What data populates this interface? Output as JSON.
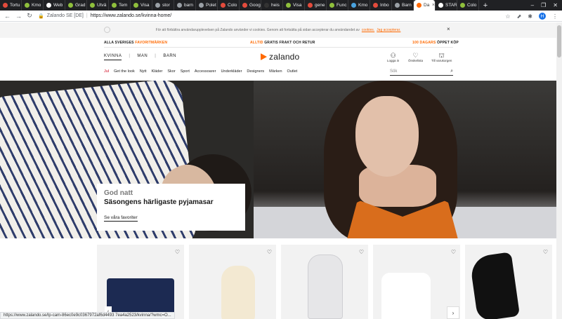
{
  "browser": {
    "tabs": [
      {
        "title": "Tortu",
        "color": "#e34b3c"
      },
      {
        "title": "Kmo",
        "color": "#8fbf3c"
      },
      {
        "title": "Web",
        "color": "#ffffff"
      },
      {
        "title": "Grad",
        "color": "#8fbf3c"
      },
      {
        "title": "Utvä",
        "color": "#8fbf3c"
      },
      {
        "title": "Tem",
        "color": "#8fbf3c"
      },
      {
        "title": "Visa",
        "color": "#8fbf3c"
      },
      {
        "title": "stor",
        "color": "#9aa0a6"
      },
      {
        "title": "barn",
        "color": "#9aa0a6"
      },
      {
        "title": "Polet",
        "color": "#9aa0a6"
      },
      {
        "title": "Colo",
        "color": "#e34b3c"
      },
      {
        "title": "Goog",
        "color": "#e34b3c"
      },
      {
        "title": "heis",
        "color": "#333333"
      },
      {
        "title": "Visa",
        "color": "#8fbf3c"
      },
      {
        "title": "gene",
        "color": "#e34b3c"
      },
      {
        "title": "Func",
        "color": "#8fbf3c"
      },
      {
        "title": "Kmo",
        "color": "#4aa3df"
      },
      {
        "title": "Inbo",
        "color": "#e34b3c"
      },
      {
        "title": "Barn",
        "color": "#9aa0a6"
      },
      {
        "title": "Da",
        "color": "#ff6900",
        "active": true
      },
      {
        "title": "STAR",
        "color": "#ffffff"
      },
      {
        "title": "Colo",
        "color": "#8fbf3c"
      }
    ],
    "new_tab": "+",
    "window_controls": [
      "–",
      "❐",
      "✕"
    ],
    "site_label": "Zalando SE [DE]",
    "url": "https://www.zalando.se/kvinna-home/",
    "url_divider": "|",
    "profile_initial": "H",
    "status_url": "https://www.zalando.se/lp-cam-86ec0e9c0367972af6d4493 7ea4a2523/kvinna/?wmc=O..."
  },
  "cookie_banner": {
    "text": "För att förbättra användarupplevelsen på Zalando använder vi cookies. Genom att fortsätta på sidan accepterar du användandet av",
    "link_cookies": "cookies.",
    "link_accept": "Jag accepterar.",
    "close": "×"
  },
  "promo": {
    "left_a": "ALLA SVERIGES",
    "left_b": "FAVORITMÄRKEN",
    "mid_a": "ALLTID",
    "mid_b": "GRATIS FRAKT OCH RETUR",
    "right_a": "100 DAGARS",
    "right_b": "ÖPPET KÖP"
  },
  "header": {
    "genders": [
      "KVINNA",
      "MAN",
      "BARN"
    ],
    "gender_sep": "|",
    "logo": "zalando",
    "login": "Logga in",
    "wishlist": "Önskelista",
    "cart": "Till varukorgen"
  },
  "categories": [
    "Jul",
    "Get the look",
    "Nytt",
    "Kläder",
    "Skor",
    "Sport",
    "Accessoarer",
    "Underkläder",
    "Designers",
    "Märken",
    "Outlet"
  ],
  "search": {
    "placeholder": "Sök"
  },
  "hero": {
    "pre": "God natt",
    "title": "Säsongens härligaste pyjamasar",
    "link": "Se våra favoriter"
  },
  "products": {
    "items": [
      "navy-shorts",
      "fluffy-slippers",
      "unicorn-onesie",
      "white-top",
      "black-tights"
    ],
    "next": "›",
    "prev": "‹"
  },
  "colors": {
    "accent": "#ff6900",
    "sale_red": "#d0021b"
  }
}
